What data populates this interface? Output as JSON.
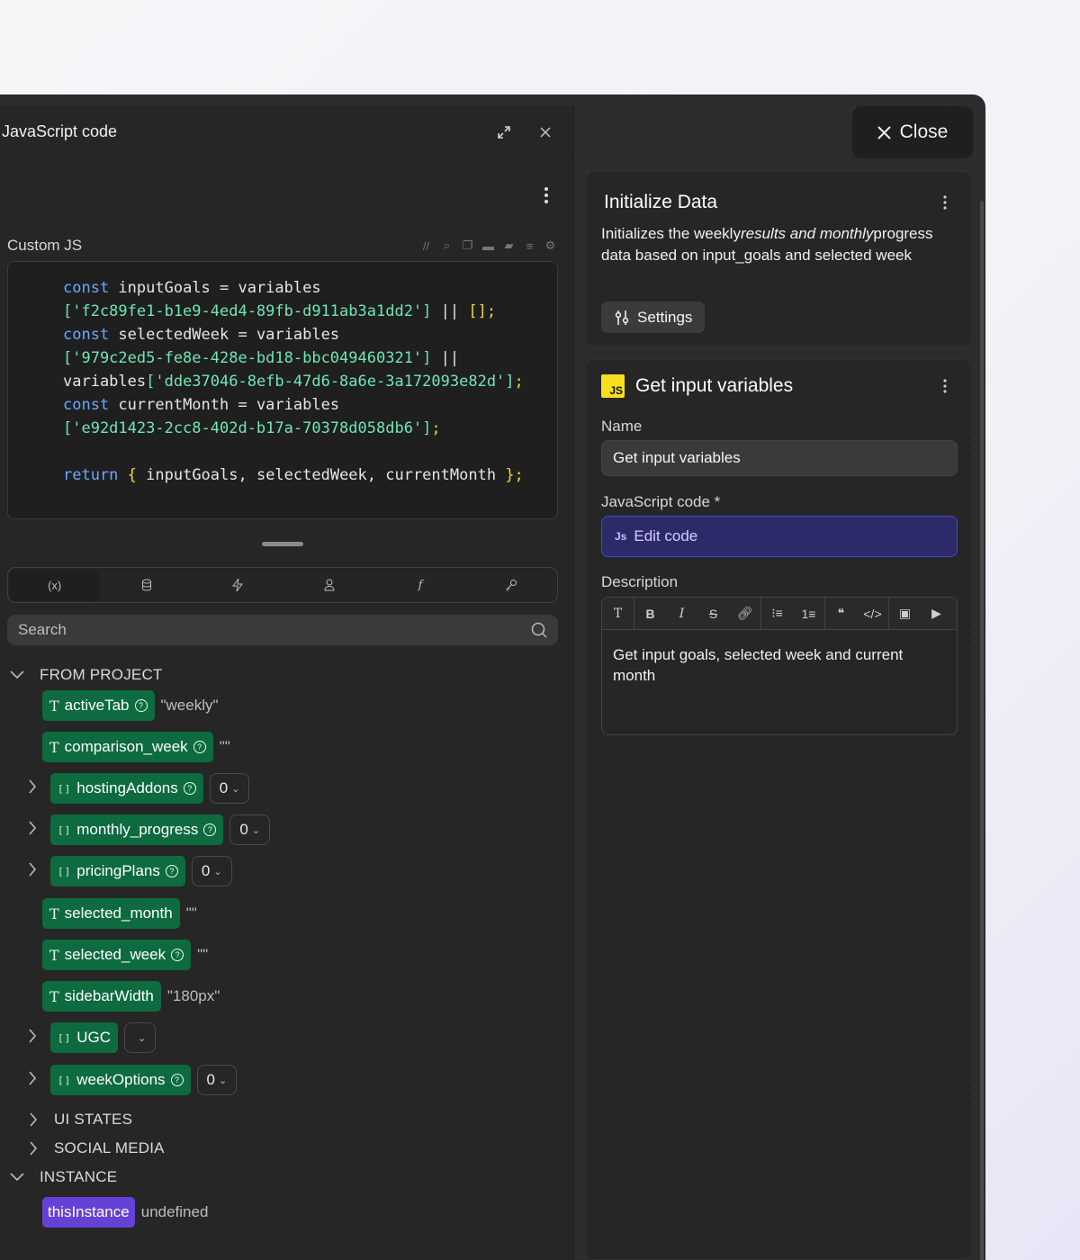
{
  "left_panel": {
    "title": "JavaScript code",
    "custom_js_label": "Custom JS",
    "toolbar_icons": [
      "comment-icon",
      "search-icon",
      "copy-icon",
      "folder-icon",
      "folder-open-icon",
      "format-icon",
      "gear-icon"
    ],
    "code_lines": [
      {
        "kw": "const",
        "rest": " inputGoals = variables"
      },
      {
        "str": "['f2c89fe1-b1e9-4ed4-89fb-d911ab3a1dd2']",
        "rest": " || ",
        "br": "[];"
      },
      {
        "kw": "const",
        "rest": " selectedWeek = variables"
      },
      {
        "str": "['979c2ed5-fe8e-428e-bd18-bbc049460321']",
        "rest": " ||"
      },
      {
        "pre": "variables",
        "str": "['dde37046-8efb-47d6-8a6e-3a172093e82d']",
        "br": ";"
      },
      {
        "kw": "const",
        "rest": " currentMonth = variables"
      },
      {
        "str": "['e92d1423-2cc8-402d-b17a-70378d058db6']",
        "br": ";"
      },
      {
        "rest": ""
      },
      {
        "kw": "return",
        "br": " {",
        "rest": " inputGoals, selectedWeek, currentMonth ",
        "br2": "};"
      }
    ],
    "tabs": [
      "(x)",
      "db",
      "bolt",
      "user",
      "f",
      "key"
    ],
    "search_placeholder": "Search",
    "sections": {
      "from_project": "FROM PROJECT",
      "ui_states": "UI STATES",
      "social_media": "SOCIAL MEDIA",
      "instance": "INSTANCE"
    },
    "variables": [
      {
        "name": "activeTab",
        "type": "T",
        "value": "\"weekly\""
      },
      {
        "name": "comparison_week",
        "type": "T",
        "value": "\"\""
      },
      {
        "name": "hostingAddons",
        "type": "[]",
        "count": "0"
      },
      {
        "name": "monthly_progress",
        "type": "[]",
        "count": "0"
      },
      {
        "name": "pricingPlans",
        "type": "[]",
        "count": "0"
      },
      {
        "name": "selected_month",
        "type": "T",
        "value": "\"\""
      },
      {
        "name": "selected_week",
        "type": "T",
        "value": "\"\""
      },
      {
        "name": "sidebarWidth",
        "type": "T",
        "value": "\"180px\""
      },
      {
        "name": "UGC",
        "type": "[]",
        "count": ""
      },
      {
        "name": "weekOptions",
        "type": "[]",
        "count": "0"
      }
    ],
    "instance": {
      "name": "thisInstance",
      "value": "undefined"
    }
  },
  "close_label": "Close",
  "card1": {
    "title": "Initialize Data",
    "desc_1": "Initializes the weekly",
    "desc_2": "results and monthly",
    "desc_3": "progress data based on input_goals and selected week",
    "settings_label": "Settings"
  },
  "card2": {
    "title": "Get input variables",
    "name_label": "Name",
    "name_value": "Get input variables",
    "code_label": "JavaScript code *",
    "edit_code": "Edit code",
    "js_badge": "JS",
    "js_small": "Js",
    "desc_label": "Description",
    "desc_text": "Get input goals, selected week and current month"
  },
  "colors": {
    "accent": "#0d6b3f",
    "edit": "#2d2a6a",
    "instance": "#6541d6",
    "js": "#f7df1e"
  }
}
